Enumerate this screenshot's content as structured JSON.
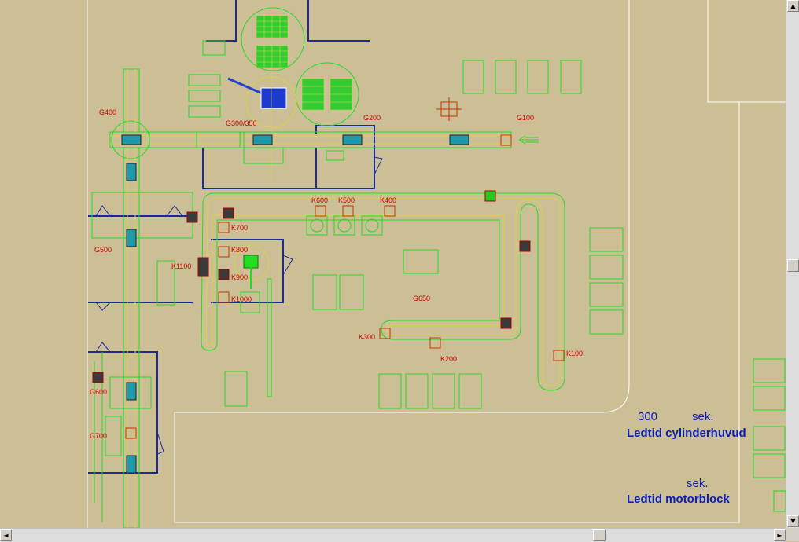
{
  "labels": {
    "g400": "G400",
    "g300": "G300/350",
    "g200": "G200",
    "g100": "G100",
    "g500": "G500",
    "g600": "G600",
    "g700": "G700",
    "g650": "G650",
    "k100": "K100",
    "k200": "K200",
    "k300": "K300",
    "k400": "K400",
    "k500": "K500",
    "k600": "K600",
    "k700": "K700",
    "k800": "K800",
    "k900": "K900",
    "k1000": "K1000",
    "k1100": "K1100"
  },
  "info": {
    "cyl_value": "300",
    "cyl_unit": "sek.",
    "cyl_title": "Ledtid cylinderhuvud",
    "block_unit": "sek.",
    "block_title": "Ledtid motorblock"
  },
  "icons": {
    "up": "▲",
    "down": "▼",
    "left": "◄",
    "right": "►"
  },
  "colors": {
    "background": "#cdbf95",
    "conveyor": "#22dd22",
    "wall": "#1a2a9a",
    "label": "#cc0000",
    "info_text": "#0a1fb8"
  }
}
